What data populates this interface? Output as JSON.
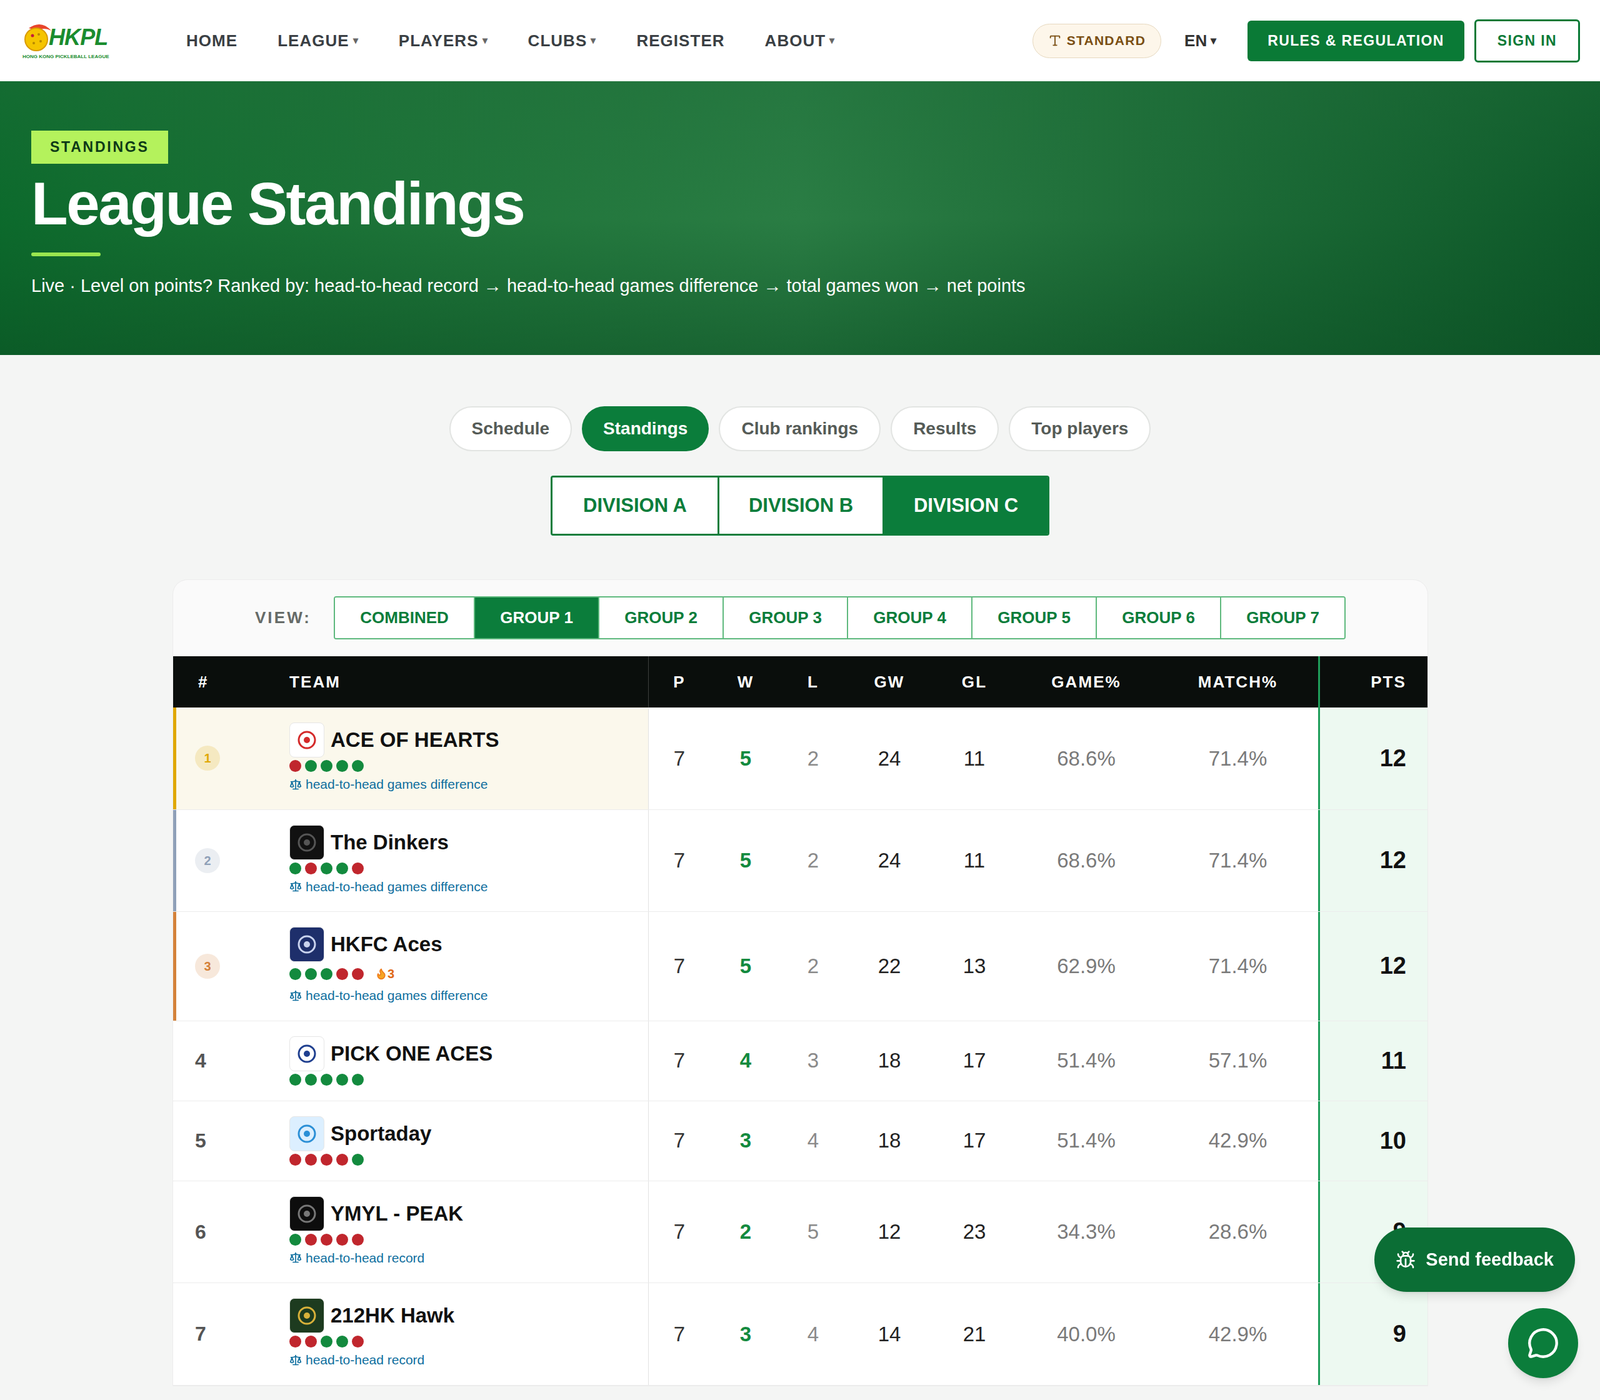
{
  "header": {
    "logo": {
      "title": "HKPL",
      "tagline": "HONG KONG PICKLEBALL LEAGUE"
    },
    "nav": [
      {
        "label": "HOME"
      },
      {
        "label": "LEAGUE",
        "caret": "▾"
      },
      {
        "label": "PLAYERS",
        "caret": "▾"
      },
      {
        "label": "CLUBS",
        "caret": "▾"
      },
      {
        "label": "REGISTER"
      },
      {
        "label": "ABOUT",
        "caret": "▾"
      }
    ],
    "font_toggle": "STANDARD",
    "language": {
      "label": "EN",
      "caret": "▾"
    },
    "buttons": [
      "RULES & REGULATION",
      "SIGN IN"
    ]
  },
  "hero": {
    "badge": "STANDINGS",
    "title": "League Standings",
    "subtitle": "Live · Level on points? Ranked by: head-to-head record → head-to-head games difference → total games won → net points"
  },
  "tabs": [
    {
      "label": "Schedule",
      "selected": false
    },
    {
      "label": "Standings",
      "selected": true
    },
    {
      "label": "Club rankings",
      "selected": false
    },
    {
      "label": "Results",
      "selected": false
    },
    {
      "label": "Top players",
      "selected": false
    }
  ],
  "divisions": [
    {
      "label": "DIVISION A",
      "selected": false
    },
    {
      "label": "DIVISION B",
      "selected": false
    },
    {
      "label": "DIVISION C",
      "selected": true
    }
  ],
  "view": {
    "label": "VIEW:",
    "options": [
      {
        "label": "COMBINED",
        "selected": false
      },
      {
        "label": "GROUP 1",
        "selected": true
      },
      {
        "label": "GROUP 2",
        "selected": false
      },
      {
        "label": "GROUP 3",
        "selected": false
      },
      {
        "label": "GROUP 4",
        "selected": false
      },
      {
        "label": "GROUP 5",
        "selected": false
      },
      {
        "label": "GROUP 6",
        "selected": false
      },
      {
        "label": "GROUP 7",
        "selected": false
      }
    ]
  },
  "table": {
    "columns": [
      "#",
      "TEAM",
      "P",
      "W",
      "L",
      "GW",
      "GL",
      "GAME%",
      "MATCH%",
      "PTS"
    ],
    "rows": [
      {
        "rank": "1",
        "rank_color": "#e0a800",
        "highlighted": true,
        "team": "ACE OF HEARTS",
        "logo_color": "#ffffff",
        "logo_mark": "#d42a2a",
        "form": [
          {
            "won": false
          },
          {
            "won": true
          },
          {
            "won": true
          },
          {
            "won": true
          },
          {
            "won": true
          }
        ],
        "tiebreak": "head-to-head games difference",
        "p": "7",
        "w": "5",
        "l": "2",
        "gw": "24",
        "gl": "11",
        "game_pct": "68.6%",
        "match_pct": "71.4%",
        "pts": "12"
      },
      {
        "rank": "2",
        "rank_color": "#8fa0b8",
        "highlighted": false,
        "team": "The Dinkers",
        "logo_color": "#111111",
        "logo_mark": "#555555",
        "form": [
          {
            "won": true
          },
          {
            "won": false
          },
          {
            "won": true
          },
          {
            "won": true
          },
          {
            "won": false
          }
        ],
        "tiebreak": "head-to-head games difference",
        "p": "7",
        "w": "5",
        "l": "2",
        "gw": "24",
        "gl": "11",
        "game_pct": "68.6%",
        "match_pct": "71.4%",
        "pts": "12"
      },
      {
        "rank": "3",
        "rank_color": "#d4823a",
        "highlighted": false,
        "team": "HKFC Aces",
        "logo_color": "#1e2f6b",
        "logo_mark": "#c9d3ee",
        "form": [
          {
            "won": true
          },
          {
            "won": true
          },
          {
            "won": true
          },
          {
            "won": false
          },
          {
            "won": false
          }
        ],
        "streak": "3",
        "tiebreak": "head-to-head games difference",
        "p": "7",
        "w": "5",
        "l": "2",
        "gw": "22",
        "gl": "13",
        "game_pct": "62.9%",
        "match_pct": "71.4%",
        "pts": "12"
      },
      {
        "rank": "4",
        "highlighted": false,
        "team": "PICK ONE ACES",
        "logo_color": "#ffffff",
        "logo_mark": "#1f3f8f",
        "form": [
          {
            "won": true
          },
          {
            "won": true
          },
          {
            "won": true
          },
          {
            "won": true
          },
          {
            "won": true
          }
        ],
        "p": "7",
        "w": "4",
        "l": "3",
        "gw": "18",
        "gl": "17",
        "game_pct": "51.4%",
        "match_pct": "57.1%",
        "pts": "11"
      },
      {
        "rank": "5",
        "highlighted": false,
        "team": "Sportaday",
        "logo_color": "#dcefff",
        "logo_mark": "#2b8fd6",
        "form": [
          {
            "won": false
          },
          {
            "won": false
          },
          {
            "won": false
          },
          {
            "won": false
          },
          {
            "won": true
          }
        ],
        "p": "7",
        "w": "3",
        "l": "4",
        "gw": "18",
        "gl": "17",
        "game_pct": "51.4%",
        "match_pct": "42.9%",
        "pts": "10"
      },
      {
        "rank": "6",
        "highlighted": false,
        "team": "YMYL - PEAK",
        "logo_color": "#0d0d0d",
        "logo_mark": "#777777",
        "form": [
          {
            "won": true
          },
          {
            "won": false
          },
          {
            "won": false
          },
          {
            "won": false
          },
          {
            "won": false
          }
        ],
        "tiebreak": "head-to-head record",
        "p": "7",
        "w": "2",
        "l": "5",
        "gw": "12",
        "gl": "23",
        "game_pct": "34.3%",
        "match_pct": "28.6%",
        "pts": "9"
      },
      {
        "rank": "7",
        "highlighted": false,
        "team": "212HK Hawk",
        "logo_color": "#1d3b1f",
        "logo_mark": "#d8b13a",
        "form": [
          {
            "won": false
          },
          {
            "won": false
          },
          {
            "won": true
          },
          {
            "won": true
          },
          {
            "won": false
          }
        ],
        "tiebreak": "head-to-head record",
        "p": "7",
        "w": "3",
        "l": "4",
        "gw": "14",
        "gl": "21",
        "game_pct": "40.0%",
        "match_pct": "42.9%",
        "pts": "9"
      }
    ]
  },
  "feedback_button": "Send feedback"
}
